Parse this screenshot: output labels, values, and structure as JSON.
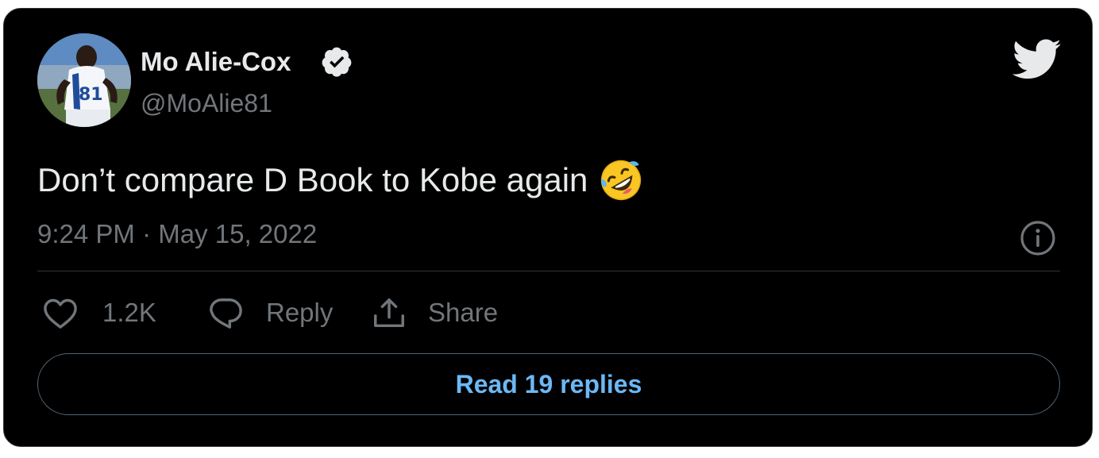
{
  "author": {
    "name": "Mo Alie-Cox",
    "handle": "@MoAlie81",
    "verified": true,
    "jersey_number": "81"
  },
  "tweet": {
    "text": "Don’t compare D Book to Kobe again",
    "emoji": "rolling-on-the-floor-laughing-icon",
    "timestamp": "9:24 PM · May 15, 2022"
  },
  "actions": {
    "like_count": "1.2K",
    "reply_label": "Reply",
    "share_label": "Share"
  },
  "read_replies_label": "Read 19 replies",
  "icons": {
    "brand": "twitter-bird-icon",
    "verified": "verified-badge-icon",
    "info": "info-icon",
    "like": "heart-icon",
    "reply": "speech-bubble-icon",
    "share": "share-upload-icon"
  },
  "colors": {
    "background": "#000000",
    "text": "#e7e9ea",
    "muted": "#71767b",
    "accent": "#6cb8f5",
    "border": "#2f3336"
  }
}
